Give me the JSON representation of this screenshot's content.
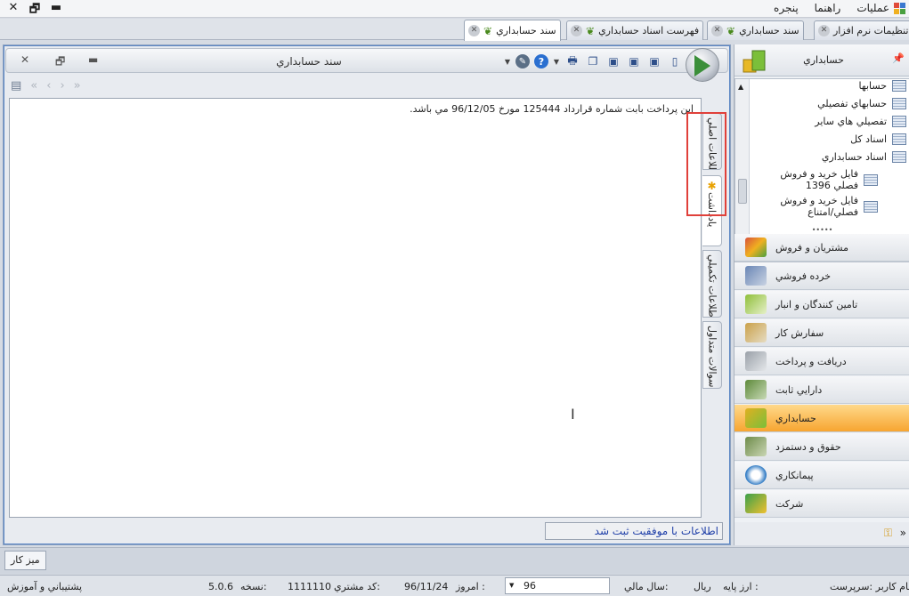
{
  "menu": {
    "items": [
      "عمليات",
      "راهنما",
      "پنجره"
    ],
    "window_controls": [
      "✕",
      "🗗",
      "▬"
    ]
  },
  "doctabs": [
    {
      "label": "تنظيمات نرم افزار"
    },
    {
      "label": "سند حسابداري"
    },
    {
      "label": "فهرست اسناد حسابداري"
    },
    {
      "label": "سند حسابداري"
    }
  ],
  "document": {
    "title": "سند حسابداري",
    "memo_text": "اين پرداخت بابت شماره قرارداد 125444 مورخ 96/12/05 مي باشد.",
    "side_tabs": [
      "اطلاعات اصلي",
      "يادداشت",
      "اطلاعات تکميلي",
      "سوالات متداول"
    ],
    "status_message": "اطلاعات با موفقيت ثبت شد"
  },
  "right_panel": {
    "header_title": "حسابداري",
    "tree_items": [
      "حسابها",
      "حسابهاي تفصيلي",
      "تفصيلي هاي ساير",
      "اسناد کل",
      "اسناد حسابداري",
      "فايل خريد و فروش فصلي 1396",
      "فايل خريد و فروش فصلي/امتناع"
    ],
    "nav_groups": [
      {
        "label": "مشتريان و فروش",
        "color": "#d8523a"
      },
      {
        "label": "خرده فروشي",
        "color": "#6a86b5"
      },
      {
        "label": "تامين کنندگان و انبار",
        "color": "#8fbf3a"
      },
      {
        "label": "سفارش کار",
        "color": "#caa14a"
      },
      {
        "label": "دريافت و پرداخت",
        "color": "#9aa0a8"
      },
      {
        "label": "دارايي ثابت",
        "color": "#5e8a3a"
      },
      {
        "label": "حسابداري",
        "color": "#e0b020"
      },
      {
        "label": "حقوق و دستمزد",
        "color": "#6f8c4a"
      },
      {
        "label": "پيمانکاري",
        "color": "#2f7ac4"
      },
      {
        "label": "شرکت",
        "color": "#3aa04a"
      }
    ],
    "active_group": "حسابداري"
  },
  "taskbar": {
    "desk_button": "ميز کار"
  },
  "statusbar": {
    "user": "نام کاربر :سرپرست",
    "base_currency_label": "ارز پايه :",
    "base_currency": "ريال",
    "fiscal_year_label": "سال مالي:",
    "fiscal_year": "96",
    "today_label": "امروز :",
    "today": "96/11/24",
    "customer_code_label": "کد مشتري:",
    "customer_code": "1111110",
    "version_label": "نسخه:",
    "version": "5.0.6",
    "support": "پشتيباني و آموزش"
  },
  "colors": {
    "accent": "#f7a530",
    "status_text": "#1f3fa8",
    "highlight": "#e0403a"
  }
}
